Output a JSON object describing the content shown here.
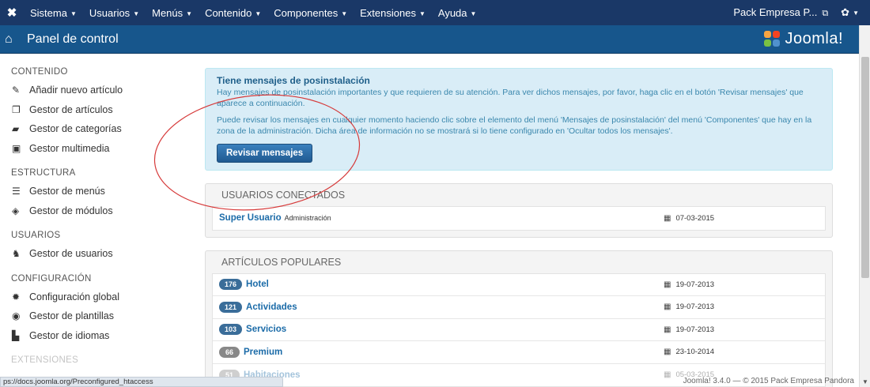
{
  "topbar": {
    "menus": [
      "Sistema",
      "Usuarios",
      "Menús",
      "Contenido",
      "Componentes",
      "Extensiones",
      "Ayuda"
    ],
    "site_name": "Pack Empresa P...",
    "gear_icon": "gear-icon"
  },
  "header": {
    "title": "Panel de control",
    "logo_text": "Joomla!"
  },
  "sidebar": {
    "sections": [
      {
        "heading": "CONTENIDO",
        "items": [
          {
            "label": "Añadir nuevo artículo",
            "icon": "pencil-icon"
          },
          {
            "label": "Gestor de artículos",
            "icon": "copy-icon"
          },
          {
            "label": "Gestor de categorías",
            "icon": "folder-icon"
          },
          {
            "label": "Gestor multimedia",
            "icon": "image-icon"
          }
        ]
      },
      {
        "heading": "ESTRUCTURA",
        "items": [
          {
            "label": "Gestor de menús",
            "icon": "list-icon"
          },
          {
            "label": "Gestor de módulos",
            "icon": "cube-icon"
          }
        ]
      },
      {
        "heading": "USUARIOS",
        "items": [
          {
            "label": "Gestor de usuarios",
            "icon": "users-icon"
          }
        ]
      },
      {
        "heading": "CONFIGURACIÓN",
        "items": [
          {
            "label": "Configuración global",
            "icon": "cog-icon"
          },
          {
            "label": "Gestor de plantillas",
            "icon": "eye-icon"
          },
          {
            "label": "Gestor de idiomas",
            "icon": "comments-icon"
          }
        ]
      }
    ],
    "partial_heading": "EXTENSIONES"
  },
  "alert": {
    "title": "Tiene mensajes de posinstalación",
    "text1": "Hay mensajes de posinstalación importantes y que requieren de su atención. Para ver dichos mensajes, por favor, haga clic en el botón 'Revisar mensajes' que aparece a continuación.",
    "text2": "Puede revisar los mensajes en cualquier momento haciendo clic sobre el elemento del menú 'Mensajes de posinstalación' del menú 'Componentes' que hay en la zona de la administración. Dicha área de información no se mostrará si lo tiene configurado en 'Ocultar todos los mensajes'.",
    "button": "Revisar mensajes"
  },
  "logged_users": {
    "title": "USUARIOS CONECTADOS",
    "rows": [
      {
        "name": "Super Usuario",
        "role": "Administración",
        "date": "07-03-2015"
      }
    ]
  },
  "popular": {
    "title": "ARTÍCULOS POPULARES",
    "rows": [
      {
        "hits": "176",
        "title": "Hotel",
        "date": "19-07-2013"
      },
      {
        "hits": "121",
        "title": "Actividades",
        "date": "19-07-2013"
      },
      {
        "hits": "103",
        "title": "Servicios",
        "date": "19-07-2013"
      },
      {
        "hits": "66",
        "title": "Premium",
        "date": "23-10-2014"
      },
      {
        "hits": "51",
        "title": "Habitaciones",
        "date": "05-03-2015"
      }
    ]
  },
  "statusbar": {
    "url": "ps://docs.joomla.org/Preconfigured_htaccess"
  },
  "footer": {
    "text": "Joomla! 3.4.0 — © 2015 Pack Empresa Pandora"
  }
}
